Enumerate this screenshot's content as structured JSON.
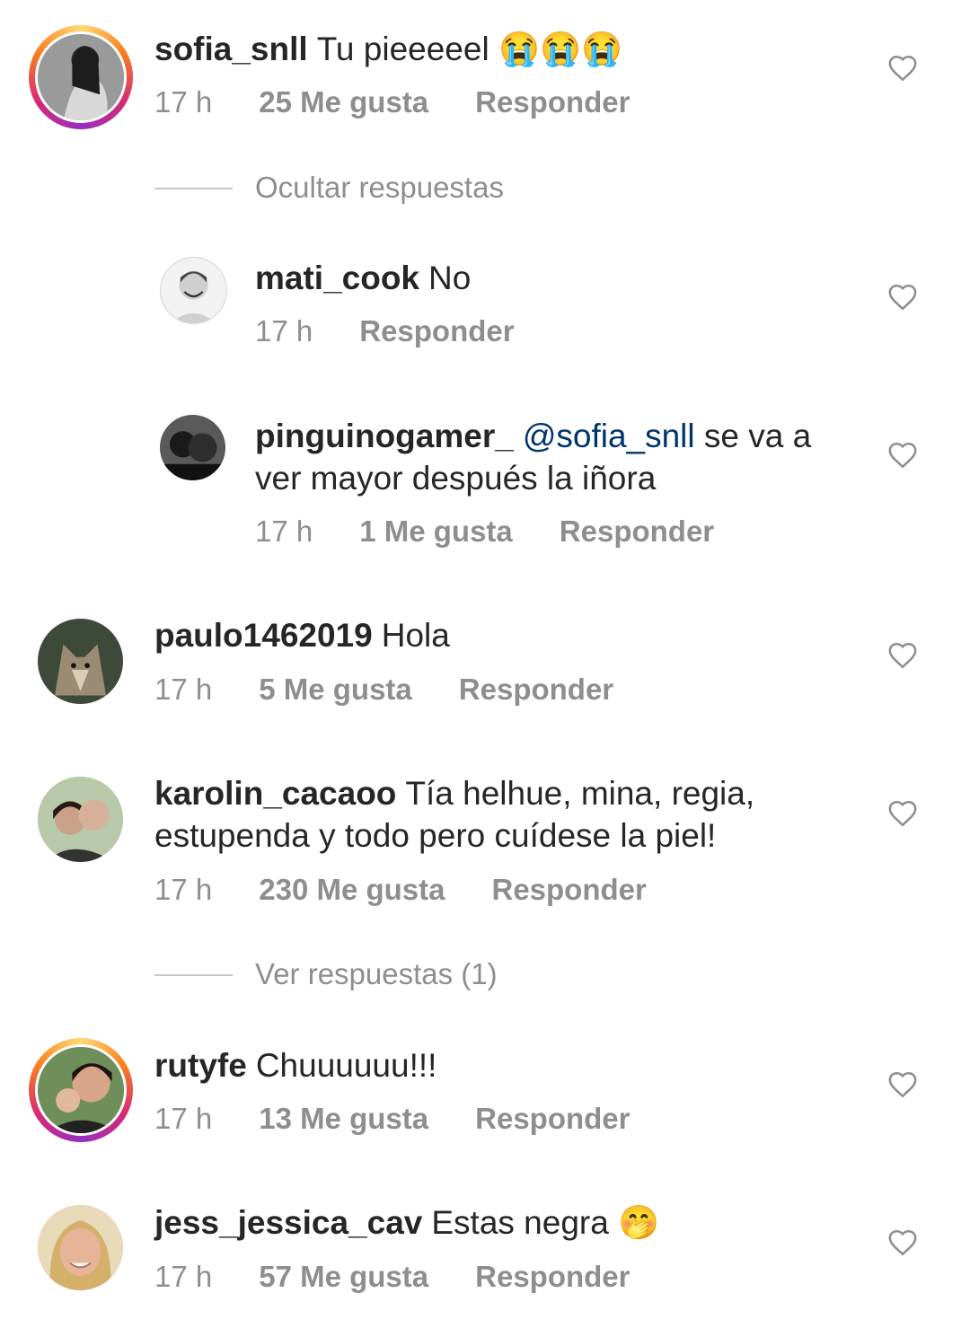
{
  "comments": [
    {
      "user": "sofia_snll",
      "text": "Tu pieeeeel 😭😭😭",
      "time": "17 h",
      "likes": "25 Me gusta",
      "reply": "Responder"
    },
    {
      "user": "mati_cook",
      "text": "No",
      "time": "17 h",
      "reply": "Responder"
    },
    {
      "user": "pinguinogamer_",
      "mention": "@sofia_snll",
      "text": " se va a ver mayor después la iñora",
      "time": "17 h",
      "likes": "1 Me gusta",
      "reply": "Responder"
    },
    {
      "user": "paulo1462019",
      "text": "Hola",
      "time": "17 h",
      "likes": "5 Me gusta",
      "reply": "Responder"
    },
    {
      "user": "karolin_cacaoo",
      "text": "Tía helhue, mina, regia, estupenda y todo pero cuídese la piel!",
      "time": "17 h",
      "likes": "230 Me gusta",
      "reply": "Responder"
    },
    {
      "user": "rutyfe",
      "text": "Chuuuuuu!!!",
      "time": "17 h",
      "likes": "13 Me gusta",
      "reply": "Responder"
    },
    {
      "user": "jess_jessica_cav",
      "text": "Estas negra 🤭",
      "time": "17 h",
      "likes": "57 Me gusta",
      "reply": "Responder"
    }
  ],
  "toggles": {
    "hide_replies": "Ocultar respuestas",
    "view_replies": "Ver respuestas (1)"
  },
  "icons": {
    "like": "heart-outline-icon"
  },
  "colors": {
    "username": "#262626",
    "meta": "#8e8e8e",
    "mention": "#003569",
    "divider": "#c7c7c7"
  }
}
